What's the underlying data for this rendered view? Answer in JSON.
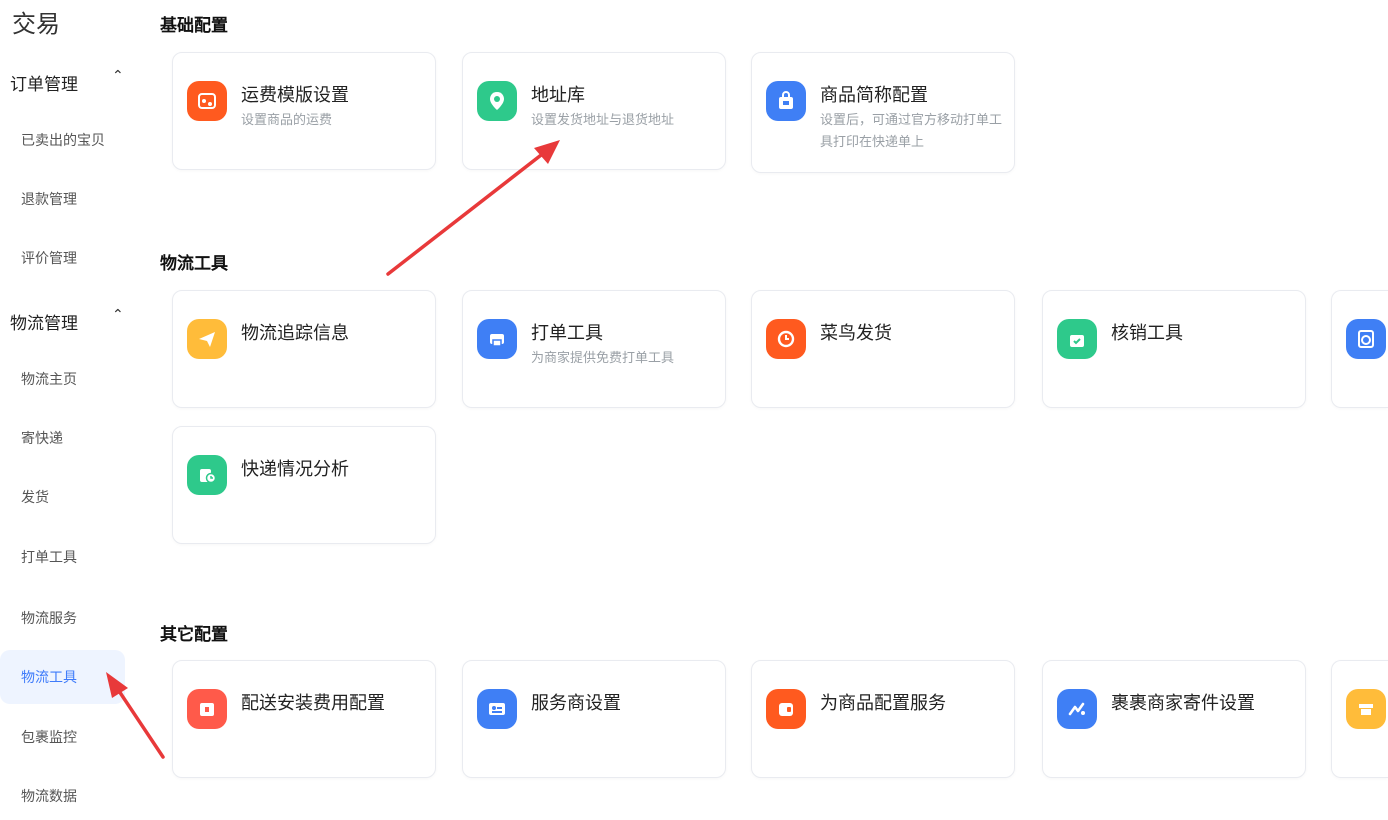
{
  "app_title": "交易",
  "sidebar": {
    "groups": [
      {
        "label": "订单管理",
        "chevron": "⌃",
        "items": [
          "已卖出的宝贝",
          "退款管理",
          "评价管理"
        ]
      },
      {
        "label": "物流管理",
        "chevron": "⌃",
        "items": [
          "物流主页",
          "寄快递",
          "发货",
          "打单工具",
          "物流服务",
          "物流工具",
          "包裹监控",
          "物流数据"
        ]
      }
    ],
    "active_item": "物流工具"
  },
  "sections": [
    {
      "title": "基础配置",
      "cards": [
        {
          "title": "运费模版设置",
          "desc": "设置商品的运费",
          "icon": "freight-template-icon",
          "color": "#ff5a1f"
        },
        {
          "title": "地址库",
          "desc": "设置发货地址与退货地址",
          "icon": "location-pin-icon",
          "color": "#2ec98b"
        },
        {
          "title": "商品简称配置",
          "desc": "设置后，可通过官方移动打单工具打印在快递单上",
          "icon": "product-bag-icon",
          "color": "#3f7ff5"
        }
      ]
    },
    {
      "title": "物流工具",
      "cards": [
        {
          "title": "物流追踪信息",
          "desc": "",
          "icon": "send-plane-icon",
          "color": "#ffbc3a"
        },
        {
          "title": "打单工具",
          "desc": "为商家提供免费打单工具",
          "icon": "printer-icon",
          "color": "#3f7ff5"
        },
        {
          "title": "菜鸟发货",
          "desc": "",
          "icon": "cainiao-icon",
          "color": "#ff5a1f"
        },
        {
          "title": "核销工具",
          "desc": "",
          "icon": "verify-bag-icon",
          "color": "#2ec98b"
        },
        {
          "title": "",
          "desc": "",
          "icon": "washer-icon",
          "color": "#3f7ff5"
        },
        {
          "title": "快递情况分析",
          "desc": "",
          "icon": "express-analysis-icon",
          "color": "#2ec98b"
        }
      ]
    },
    {
      "title": "其它配置",
      "cards": [
        {
          "title": "配送安装费用配置",
          "desc": "",
          "icon": "delivery-install-icon",
          "color": "#ff5a4a"
        },
        {
          "title": "服务商设置",
          "desc": "",
          "icon": "provider-card-icon",
          "color": "#3f7ff5"
        },
        {
          "title": "为商品配置服务",
          "desc": "",
          "icon": "service-config-icon",
          "color": "#ff5a1f"
        },
        {
          "title": "裹裹商家寄件设置",
          "desc": "",
          "icon": "guoguo-icon",
          "color": "#3f7ff5"
        },
        {
          "title": "",
          "desc": "",
          "icon": "box-icon",
          "color": "#ffbc3a"
        }
      ]
    }
  ],
  "annotations": {
    "arrow_color": "#e8393a"
  }
}
